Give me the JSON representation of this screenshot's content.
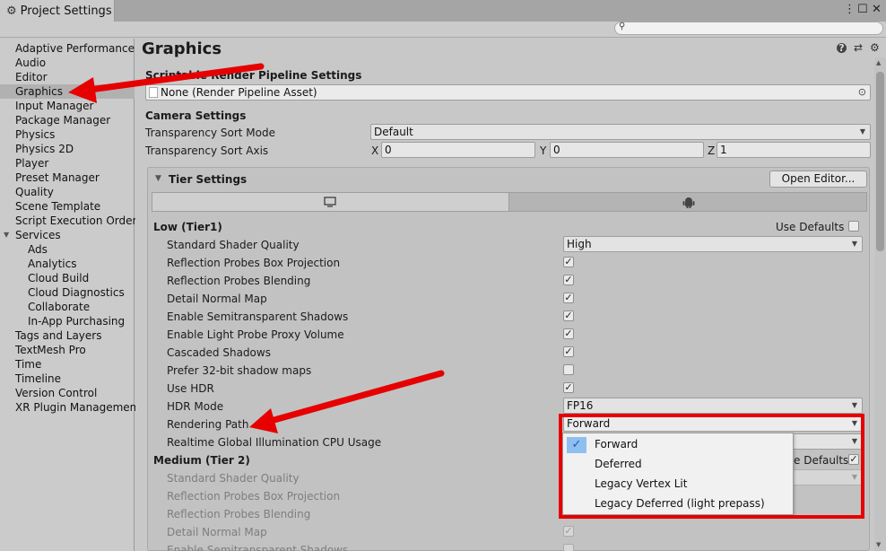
{
  "window": {
    "title": "Project Settings"
  },
  "search": {
    "placeholder": ""
  },
  "sidebar": {
    "items": [
      {
        "label": "Adaptive Performance"
      },
      {
        "label": "Audio"
      },
      {
        "label": "Editor"
      },
      {
        "label": "Graphics"
      },
      {
        "label": "Input Manager"
      },
      {
        "label": "Package Manager"
      },
      {
        "label": "Physics"
      },
      {
        "label": "Physics 2D"
      },
      {
        "label": "Player"
      },
      {
        "label": "Preset Manager"
      },
      {
        "label": "Quality"
      },
      {
        "label": "Scene Template"
      },
      {
        "label": "Script Execution Order"
      },
      {
        "label": "Services"
      },
      {
        "label": "Ads"
      },
      {
        "label": "Analytics"
      },
      {
        "label": "Cloud Build"
      },
      {
        "label": "Cloud Diagnostics"
      },
      {
        "label": "Collaborate"
      },
      {
        "label": "In-App Purchasing"
      },
      {
        "label": "Tags and Layers"
      },
      {
        "label": "TextMesh Pro"
      },
      {
        "label": "Time"
      },
      {
        "label": "Timeline"
      },
      {
        "label": "Version Control"
      },
      {
        "label": "XR Plugin Management"
      }
    ]
  },
  "main": {
    "title": "Graphics",
    "srp": {
      "header": "Scriptable Render Pipeline Settings",
      "value": "None (Render Pipeline Asset)"
    },
    "camera": {
      "header": "Camera Settings",
      "sort_mode_label": "Transparency Sort Mode",
      "sort_mode_value": "Default",
      "sort_axis_label": "Transparency Sort Axis",
      "x_label": "X",
      "x_value": "0",
      "y_label": "Y",
      "y_value": "0",
      "z_label": "Z",
      "z_value": "1"
    },
    "tier": {
      "header": "Tier Settings",
      "open_editor": "Open Editor...",
      "low": {
        "title": "Low (Tier1)",
        "use_defaults": "Use Defaults",
        "rows": {
          "shader_quality": "Standard Shader Quality",
          "shader_quality_value": "High",
          "box_projection": "Reflection Probes Box Projection",
          "blending": "Reflection Probes Blending",
          "detail_normal": "Detail Normal Map",
          "semitransparent": "Enable Semitransparent Shadows",
          "light_probe_proxy": "Enable Light Probe Proxy Volume",
          "cascaded": "Cascaded Shadows",
          "prefer32": "Prefer 32-bit shadow maps",
          "use_hdr": "Use HDR",
          "hdr_mode": "HDR Mode",
          "hdr_mode_value": "FP16",
          "rendering_path": "Rendering Path",
          "rendering_path_value": "Forward",
          "rtgi": "Realtime Global Illumination CPU Usage"
        }
      },
      "medium": {
        "title": "Medium (Tier 2)",
        "use_defaults_partial": "e Defaults",
        "rows": {
          "shader_quality": "Standard Shader Quality",
          "box_projection": "Reflection Probes Box Projection",
          "blending": "Reflection Probes Blending",
          "detail_normal": "Detail Normal Map",
          "semitransparent": "Enable Semitransparent Shadows"
        }
      }
    }
  },
  "popup": {
    "options": [
      "Forward",
      "Deferred",
      "Legacy Vertex Lit",
      "Legacy Deferred (light prepass)"
    ],
    "selected": "Forward"
  },
  "colors": {
    "annotation": "#e60000",
    "selection": "#8fbff0"
  }
}
